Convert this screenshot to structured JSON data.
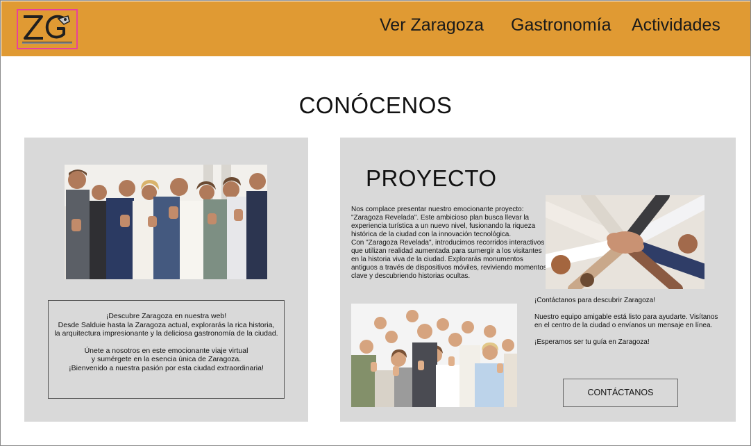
{
  "header": {
    "logo_alt": "ZG",
    "nav": {
      "ver_zaragoza": "Ver Zaragoza",
      "gastronomia": "Gastronomía",
      "actividades": "Actividades"
    }
  },
  "colors": {
    "header_bg": "#e09a33",
    "panel_bg": "#d9d9d9",
    "logo_border": "#e8419c"
  },
  "main": {
    "title": "CONÓCENOS",
    "left_panel": {
      "info_lines_1": [
        "¡Descubre Zaragoza en nuestra web!",
        "Desde Salduie hasta la Zaragoza actual, explorarás la rica historia,",
        "la arquitectura impresionante y la deliciosa gastronomía de la ciudad."
      ],
      "info_lines_2": [
        "Únete a nosotros en este emocionante viaje virtual",
        "y sumérgete en la esencia única de Zaragoza.",
        "¡Bienvenido a nuestra pasión por esta ciudad extraordinaria!"
      ]
    },
    "right_panel": {
      "title": "PROYECTO",
      "paragraph_1": "Nos complace presentar nuestro emocionante proyecto: \"Zaragoza Revelada\". Este ambicioso plan busca llevar la experiencia turística a un nuevo nivel, fusionando la riqueza histórica de la ciudad con la innovación tecnológica.",
      "paragraph_2": "Con \"Zaragoza Revelada\", introducimos recorridos interactivos que utilizan realidad aumentada para sumergir a los visitantes en la historia viva de la ciudad. Explorarás monumentos antiguos a través de dispositivos móviles, reviviendo momentos clave y descubriendo historias ocultas.",
      "contact_1": "¡Contáctanos para descubrir Zaragoza!",
      "contact_2": "Nuestro equipo amigable está listo para ayudarte. Visítanos en el centro de la ciudad o envíanos un mensaje en línea.",
      "contact_3": "¡Esperamos ser tu guía en Zaragoza!",
      "button_label": "CONTÁCTANOS"
    }
  }
}
